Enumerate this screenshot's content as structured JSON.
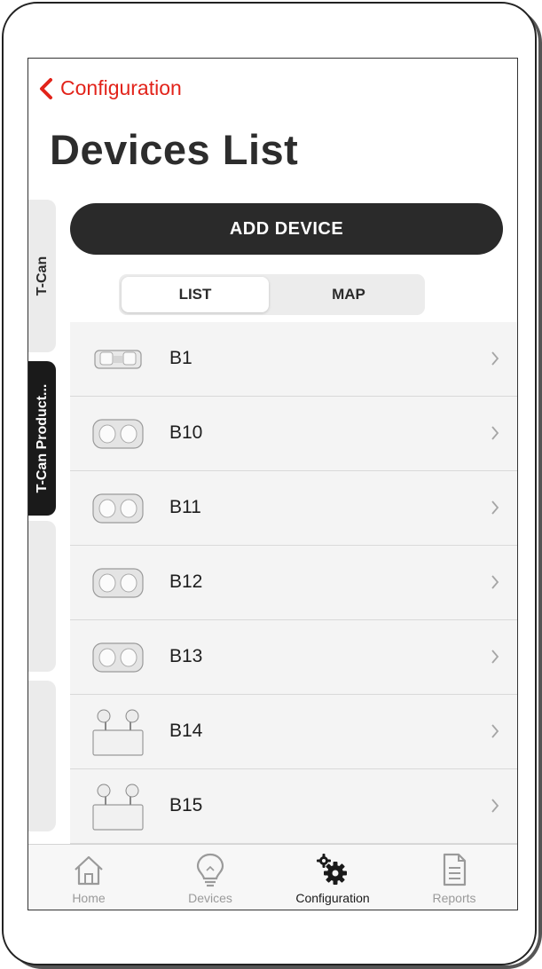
{
  "nav": {
    "back_label": "Configuration"
  },
  "page": {
    "title": "Devices List"
  },
  "side_tabs": [
    {
      "label": "T-Can",
      "active": false
    },
    {
      "label": "T-Can Product...",
      "active": true
    }
  ],
  "actions": {
    "add_device_label": "ADD DEVICE"
  },
  "view_toggle": {
    "list_label": "LIST",
    "map_label": "MAP",
    "selected": "LIST"
  },
  "devices": [
    {
      "name": "B1",
      "icon": "compact-emergency-light-icon"
    },
    {
      "name": "B10",
      "icon": "emergency-light-housing-icon"
    },
    {
      "name": "B11",
      "icon": "emergency-light-housing-icon"
    },
    {
      "name": "B12",
      "icon": "emergency-light-housing-icon"
    },
    {
      "name": "B13",
      "icon": "emergency-light-housing-icon"
    },
    {
      "name": "B14",
      "icon": "twin-head-emergency-light-icon"
    },
    {
      "name": "B15",
      "icon": "twin-head-emergency-light-icon"
    }
  ],
  "tabbar": [
    {
      "label": "Home",
      "icon": "home-icon",
      "active": false
    },
    {
      "label": "Devices",
      "icon": "lightbulb-icon",
      "active": false
    },
    {
      "label": "Configuration",
      "icon": "gears-icon",
      "active": true
    },
    {
      "label": "Reports",
      "icon": "document-icon",
      "active": false
    }
  ],
  "colors": {
    "accent": "#e2231a",
    "dark": "#2a2a2a",
    "row_bg": "#f4f4f4"
  }
}
